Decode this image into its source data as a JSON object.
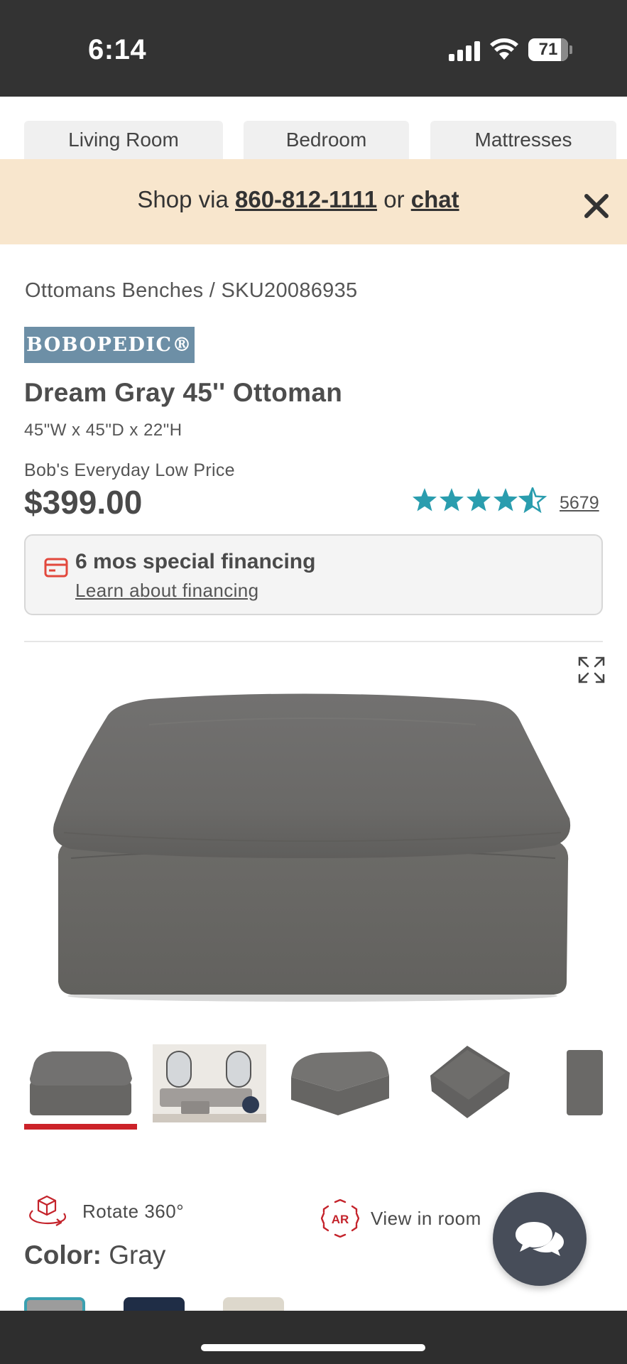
{
  "status_bar": {
    "time": "6:14",
    "battery": "71"
  },
  "tabs": [
    {
      "label": "Living Room"
    },
    {
      "label": "Bedroom"
    },
    {
      "label": "Mattresses"
    }
  ],
  "promo": {
    "prefix": "Shop via ",
    "phone": "860-812-1111",
    "middle": " or ",
    "chat": "chat"
  },
  "breadcrumb": {
    "category": "Ottomans Benches",
    "separator": "/",
    "sku": "SKU20086935"
  },
  "brand": {
    "logo_text": "BOBOPEDIC®"
  },
  "product": {
    "title": "Dream Gray 45'' Ottoman",
    "dimensions": "45\"W x 45\"D x 22\"H",
    "price_label": "Bob's Everyday Low Price",
    "price": "$399.00",
    "rating": 4.5,
    "rating_max": 5,
    "review_count": "5679"
  },
  "financing": {
    "title": "6 mos special financing",
    "link": "Learn about financing"
  },
  "actions": {
    "rotate": "Rotate 360°",
    "view_in_room": "View in room",
    "ar_badge": "AR"
  },
  "color": {
    "label": "Color:",
    "value": "Gray"
  },
  "swatches": [
    "#9c9c9c",
    "#1f2d46",
    "#ddd8cc"
  ],
  "colors": {
    "accent_teal": "#2a9dae",
    "accent_red": "#cc2229",
    "promo_bg": "#f8e6cd"
  }
}
